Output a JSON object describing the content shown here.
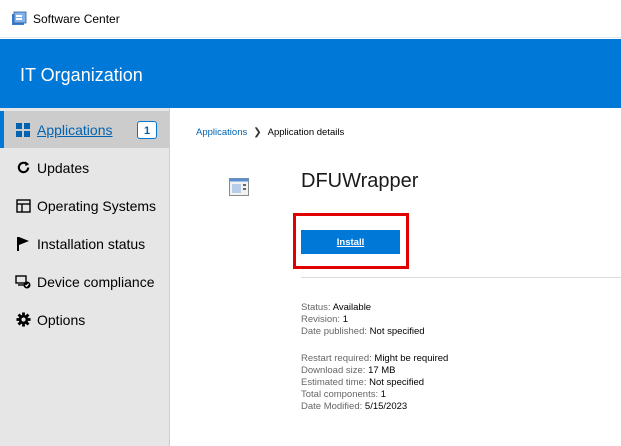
{
  "window": {
    "title": "Software Center"
  },
  "header": {
    "org_name": "IT Organization",
    "accent": "#0078d7"
  },
  "sidebar": {
    "items": [
      {
        "label": "Applications",
        "icon": "apps-grid-icon",
        "badge": "1",
        "selected": true
      },
      {
        "label": "Updates",
        "icon": "refresh-icon"
      },
      {
        "label": "Operating Systems",
        "icon": "windows-stack-icon"
      },
      {
        "label": "Installation status",
        "icon": "flag-icon"
      },
      {
        "label": "Device compliance",
        "icon": "device-compliance-icon"
      },
      {
        "label": "Options",
        "icon": "gear-icon"
      }
    ]
  },
  "breadcrumb": {
    "root": "Applications",
    "separator": "❯",
    "current": "Application details"
  },
  "app": {
    "name": "DFUWrapper",
    "install_label": "Install"
  },
  "details": {
    "status": {
      "key": "Status:",
      "value": "Available"
    },
    "revision": {
      "key": "Revision:",
      "value": "1"
    },
    "date_published": {
      "key": "Date published:",
      "value": "Not specified"
    },
    "restart_required": {
      "key": "Restart required:",
      "value": "Might be required"
    },
    "download_size": {
      "key": "Download size:",
      "value": "17 MB"
    },
    "estimated_time": {
      "key": "Estimated time:",
      "value": "Not specified"
    },
    "total_components": {
      "key": "Total components:",
      "value": "1"
    },
    "date_modified": {
      "key": "Date Modified:",
      "value": "5/15/2023"
    }
  }
}
